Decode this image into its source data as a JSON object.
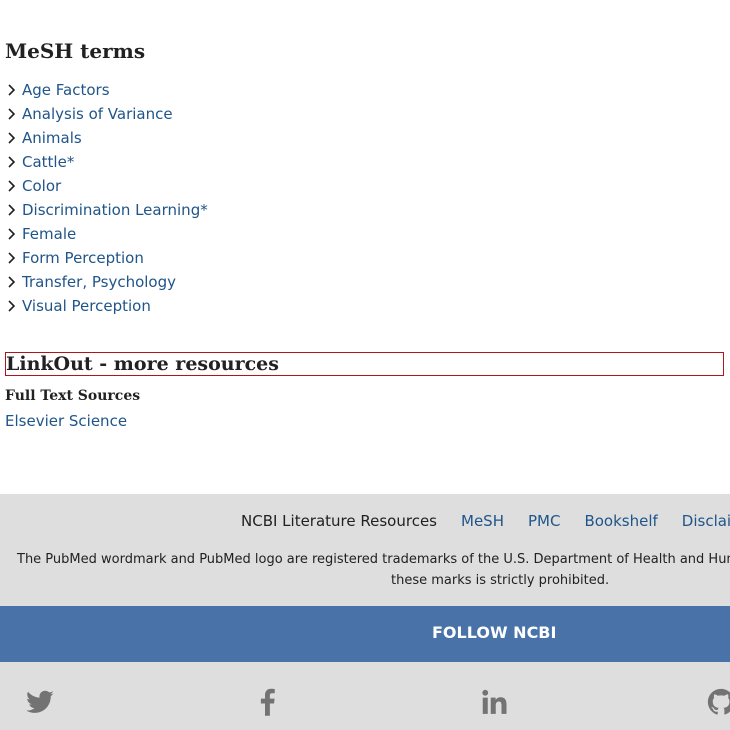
{
  "mesh": {
    "title": "MeSH terms",
    "terms": [
      "Age Factors",
      "Analysis of Variance",
      "Animals",
      "Cattle*",
      "Color",
      "Discrimination Learning*",
      "Female",
      "Form Perception",
      "Transfer, Psychology",
      "Visual Perception"
    ]
  },
  "linkout": {
    "title": "LinkOut - more resources",
    "full_text_heading": "Full Text Sources",
    "sources": [
      "Elsevier Science"
    ]
  },
  "footer": {
    "resources_label": "NCBI Literature Resources",
    "links": [
      "MeSH",
      "PMC",
      "Bookshelf",
      "Disclaimer"
    ],
    "trademark_line1": "The PubMed wordmark and PubMed logo are registered trademarks of the U.S. Department of Health and Human Services. Unauthorized use of",
    "trademark_line2": "these marks is strictly prohibited.",
    "follow_label": "FOLLOW NCBI",
    "social_icons": [
      "twitter-icon",
      "facebook-icon",
      "linkedin-icon",
      "github-icon"
    ]
  },
  "colors": {
    "link": "#20558a",
    "footer_bg": "#dedede",
    "follow_bar": "#4872a8",
    "focus_outline": "#b0151e"
  }
}
